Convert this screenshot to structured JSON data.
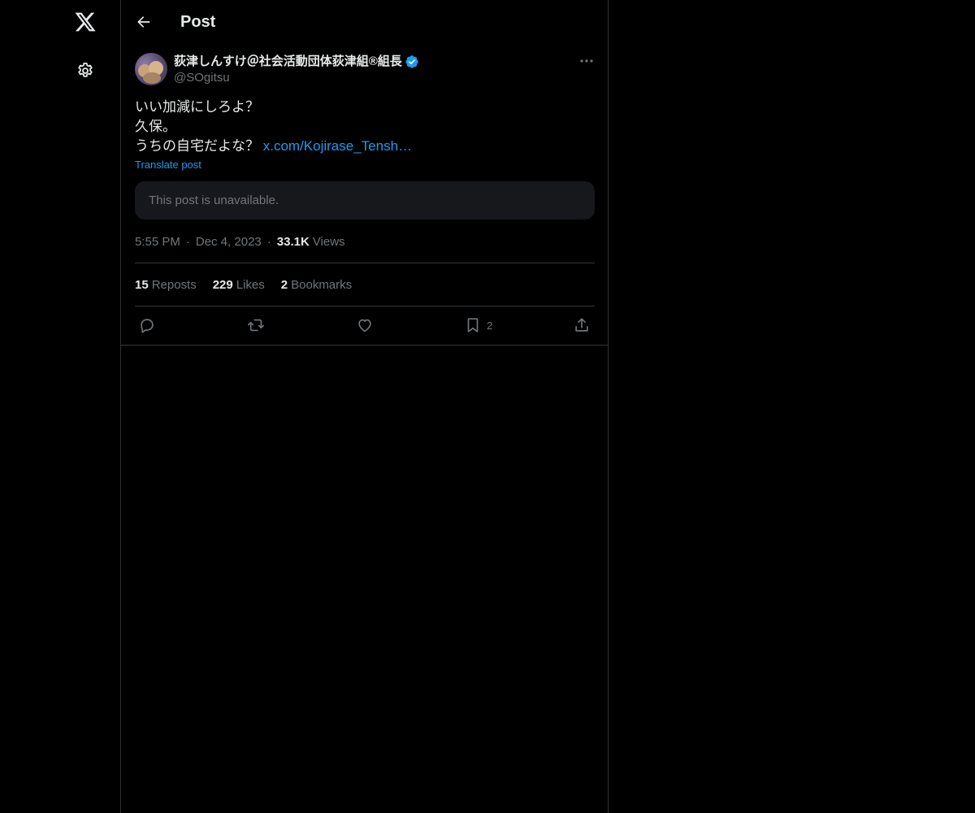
{
  "header": {
    "title": "Post"
  },
  "nav": {
    "icons": [
      "x-logo-icon",
      "settings-gear-icon"
    ]
  },
  "post": {
    "display_name": "荻津しんすけ＠社会活動団体荻津組®組長",
    "handle": "@SOgitsu",
    "verified": true,
    "text_lines": [
      "いい加減にしろよ？",
      "久保。",
      "うちの自宅だよな？ "
    ],
    "link_text": "x.com/Kojirase_Tensh…",
    "translate_label": "Translate post",
    "unavailable_message": "This post is unavailable.",
    "time": "5:55 PM",
    "date": "Dec 4, 2023",
    "views_count": "33.1K",
    "views_label": "Views",
    "stats": {
      "reposts_count": "15",
      "reposts_label": "Reposts",
      "likes_count": "229",
      "likes_label": "Likes",
      "bookmarks_count": "2",
      "bookmarks_label": "Bookmarks"
    },
    "actions": {
      "bookmark_count": "2"
    }
  },
  "colors": {
    "background": "#000000",
    "text_primary": "#e7e9ea",
    "text_secondary": "#71767b",
    "accent": "#1d9bf0",
    "border": "#2f3336",
    "card": "#16181c"
  }
}
